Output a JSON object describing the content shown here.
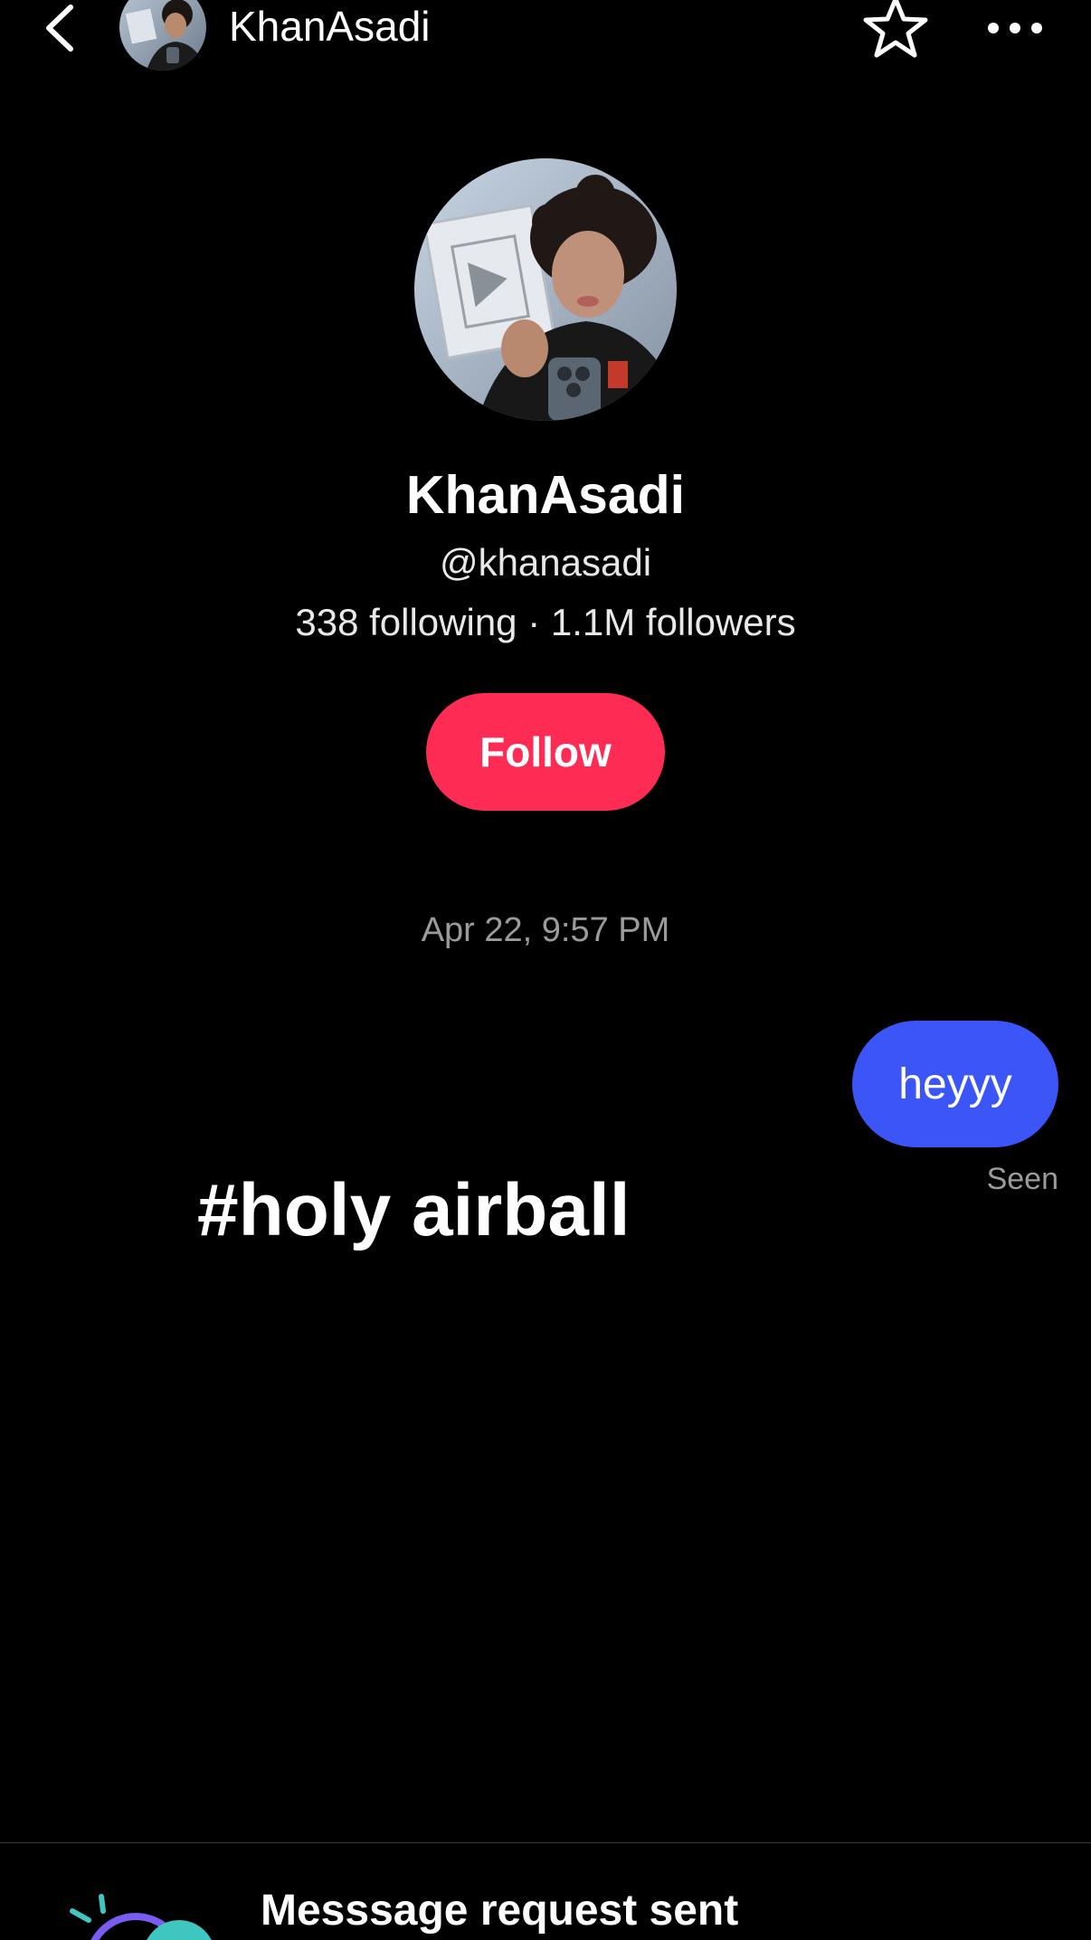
{
  "header": {
    "title": "KhanAsadi",
    "back_icon": "chevron-left-icon",
    "favorite_icon": "star-outline-icon",
    "more_icon": "ellipsis-icon"
  },
  "profile": {
    "display_name": "KhanAsadi",
    "handle": "@khanasadi",
    "stats": "338 following · 1.1M followers",
    "follow_label": "Follow"
  },
  "conversation": {
    "timestamp": "Apr 22, 9:57 PM",
    "messages": [
      {
        "from": "me",
        "text": "heyyy"
      }
    ],
    "status": "Seen",
    "overlay_text": "#holy airball"
  },
  "footer": {
    "request_title": "Messsage request sent"
  },
  "colors": {
    "background": "#000000",
    "follow_button": "#fe2c55",
    "sent_bubble": "#3b55f6",
    "muted_text": "#9b9b9b"
  }
}
